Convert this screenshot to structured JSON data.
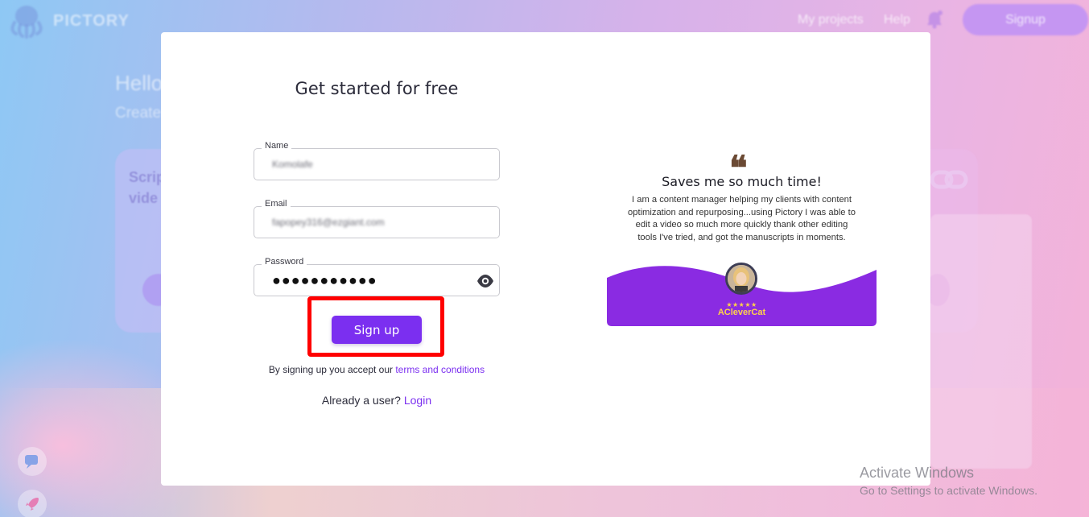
{
  "app": {
    "brand": "PICTORY"
  },
  "nav": {
    "my_projects": "My projects",
    "help": "Help",
    "signup": "Signup"
  },
  "background": {
    "hello": "Hello",
    "create": "Create",
    "card_left_title": "Scrip\nvide"
  },
  "form": {
    "title": "Get started for free",
    "name_label": "Name",
    "name_value": "Komolafe",
    "email_label": "Email",
    "email_value": "fapopey316@ezgiant.com",
    "password_label": "Password",
    "password_value": "●●●●●●●●●●●",
    "signup_button": "Sign up",
    "terms_prefix": "By signing up you accept our ",
    "terms_link": "terms and conditions",
    "login_prefix": "Already a user? ",
    "login_link": "Login"
  },
  "testimonial": {
    "quote_mark": "❝",
    "title": "Saves me so much time!",
    "body": "I am a content manager helping my clients with content optimization and repurposing...using Pictory I was able to edit a video so much more quickly thank other editing tools I've tried, and got the manuscripts in moments.",
    "stars": "★★★★★",
    "author": "ACleverCat"
  },
  "watermark": {
    "line1": "Activate Windows",
    "line2": "Go to Settings to activate Windows."
  },
  "colors": {
    "accent": "#7b2ff0",
    "highlight": "#ff0000",
    "wave": "#8a2be2"
  }
}
